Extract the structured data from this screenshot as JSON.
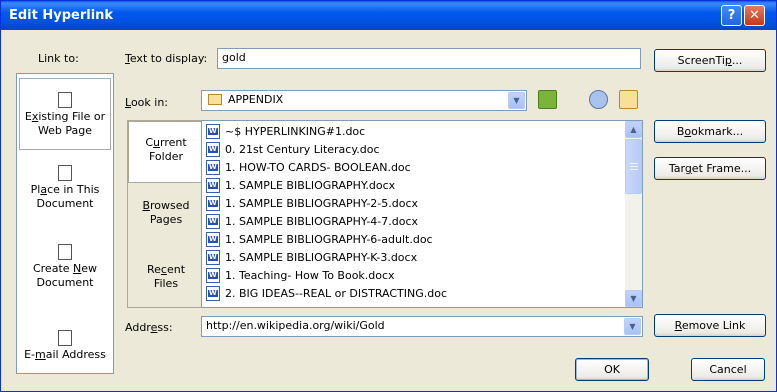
{
  "window": {
    "title": "Edit Hyperlink",
    "help_glyph": "?",
    "close_glyph": "✕"
  },
  "link_to": {
    "label": "Link to:",
    "items": [
      {
        "label_html_parts": [
          "E",
          "x",
          "isting File or",
          "Web Page"
        ],
        "id": "existing-file"
      },
      {
        "label_parts": [
          "Pl",
          "a",
          "ce in This",
          "Document"
        ]
      },
      {
        "label_parts": [
          "Create ",
          "N",
          "ew",
          "Document"
        ]
      },
      {
        "label_parts": [
          "E-",
          "m",
          "ail Address"
        ]
      }
    ]
  },
  "text_to_display": {
    "label_pre": "",
    "label_ul": "T",
    "label_post": "ext to display:",
    "value": "gold"
  },
  "look_in": {
    "label_ul": "L",
    "label_post": "ook in:",
    "value": "APPENDIX"
  },
  "tabs": [
    {
      "l1_pre": "C",
      "l1_ul": "u",
      "l1_post": "rrent",
      "l2": "Folder"
    },
    {
      "l1_pre": "",
      "l1_ul": "B",
      "l1_post": "rowsed",
      "l2": "Pages"
    },
    {
      "l1_pre": "Re",
      "l1_ul": "c",
      "l1_post": "ent",
      "l2": "Files"
    }
  ],
  "files": [
    "~$ HYPERLINKING#1.doc",
    "0. 21st Century Literacy.doc",
    "1. HOW-TO CARDS- BOOLEAN.doc",
    "1. SAMPLE BIBLIOGRAPHY.docx",
    "1. SAMPLE BIBLIOGRAPHY-2-5.docx",
    "1. SAMPLE BIBLIOGRAPHY-4-7.docx",
    "1. SAMPLE BIBLIOGRAPHY-6-adult.doc",
    "1. SAMPLE BIBLIOGRAPHY-K-3.docx",
    "1. Teaching- How To Book.docx",
    "2. BIG IDEAS--REAL or DISTRACTING.doc"
  ],
  "address": {
    "label_pre": "Addr",
    "label_ul": "e",
    "label_post": "ss:",
    "value": "http://en.wikipedia.org/wiki/Gold"
  },
  "buttons": {
    "screentip": {
      "pre": "ScreenTi",
      "ul": "p",
      "post": "..."
    },
    "bookmark": {
      "pre": "B",
      "ul": "o",
      "post": "okmark..."
    },
    "target_frame": {
      "pre": "Tar",
      "ul": "g",
      "post": "et Frame..."
    },
    "remove_link": {
      "pre": "",
      "ul": "R",
      "post": "emove Link"
    },
    "ok": "OK",
    "cancel": "Cancel"
  },
  "colors": {
    "titlebar": "#0054e3",
    "dialog_bg": "#ece9d8",
    "field_border": "#7f9db9"
  }
}
